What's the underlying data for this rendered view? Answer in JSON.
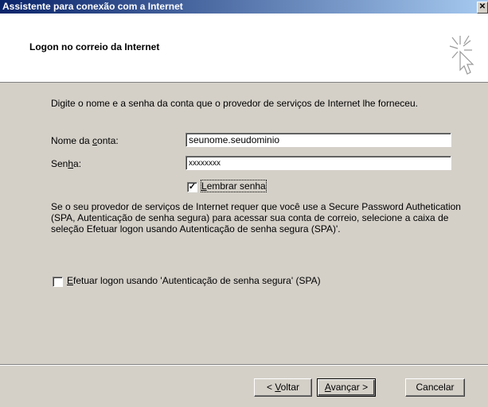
{
  "window": {
    "title": "Assistente para conexão com a Internet"
  },
  "header": {
    "title": "Logon no correio da Internet",
    "icon": "wizard-sparkle-cursor-icon"
  },
  "intro_text": "Digite o nome e a senha da conta que o provedor de serviços de Internet lhe forneceu.",
  "account": {
    "label_pre": "Nome da ",
    "label_key": "c",
    "label_post": "onta:",
    "value": "seunome.seudominio"
  },
  "password": {
    "label_pre": "Sen",
    "label_key": "h",
    "label_post": "a:",
    "value": "xxxxxxxx"
  },
  "remember": {
    "label_key": "L",
    "label_post": "embrar senha",
    "checked": true,
    "mark": "✓"
  },
  "spa_info": "Se o seu provedor de serviços de Internet requer que você use a Secure Password Authetication (SPA, Autenticação de senha segura) para acessar sua conta de correio, selecione a caixa de seleção Efetuar logon usando Autenticação de senha segura (SPA)'.",
  "spa_option": {
    "label_key": "E",
    "label_post": "fetuar logon usando 'Autenticação de senha segura' (SPA)",
    "checked": false
  },
  "buttons": {
    "back_pre": "< ",
    "back_key": "V",
    "back_post": "oltar",
    "next_key": "A",
    "next_post": "vançar >",
    "cancel": "Cancelar"
  }
}
